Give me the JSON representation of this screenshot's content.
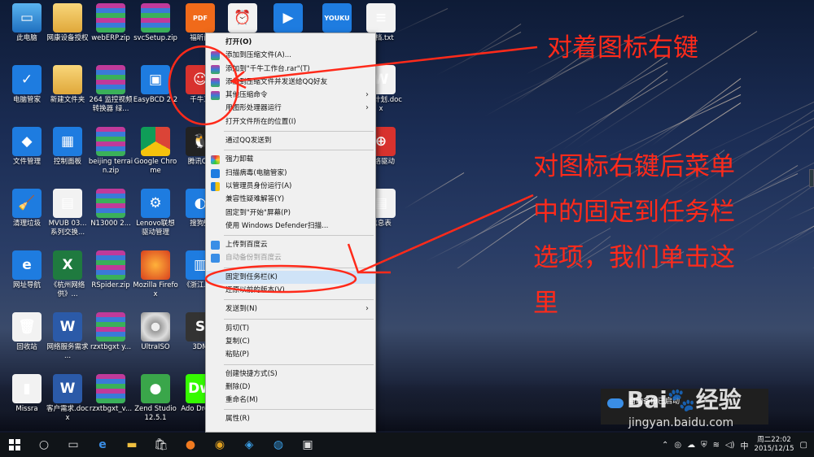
{
  "desktop_icons": [
    {
      "label": "此电脑",
      "glyph": "▭",
      "style": "g-pc",
      "col": 0,
      "row": 0
    },
    {
      "label": "网康设备授权",
      "glyph": "",
      "style": "g-folder",
      "col": 1,
      "row": 0
    },
    {
      "label": "webERP.zip",
      "glyph": "",
      "style": "g-rar",
      "col": 2,
      "row": 0
    },
    {
      "label": "svcSetup.zip",
      "glyph": "",
      "style": "g-rar",
      "col": 3,
      "row": 0
    },
    {
      "label": "福昕阅",
      "glyph": "PDF",
      "style": "g-orange",
      "col": 4,
      "row": 0
    },
    {
      "label": "",
      "glyph": "⏰",
      "style": "g-white",
      "col": 5,
      "row": 0
    },
    {
      "label": "",
      "glyph": "▶",
      "style": "g-blue",
      "col": 6,
      "row": 0
    },
    {
      "label": "",
      "glyph": "YOUKU",
      "style": "g-blue",
      "col": 7,
      "row": 0
    },
    {
      "label": "文档.txt",
      "glyph": "≡",
      "style": "g-white",
      "col": 8,
      "row": 0
    },
    {
      "label": "电脑管家",
      "glyph": "✓",
      "style": "g-blue",
      "col": 0,
      "row": 1
    },
    {
      "label": "新建文件夹",
      "glyph": "",
      "style": "g-folder",
      "col": 1,
      "row": 1
    },
    {
      "label": "264 监控视频转换器 绿...",
      "glyph": "",
      "style": "g-rar",
      "col": 2,
      "row": 1
    },
    {
      "label": "EasyBCD 2.2",
      "glyph": "▣",
      "style": "g-blue",
      "col": 3,
      "row": 1
    },
    {
      "label": "千牛工",
      "glyph": "☺",
      "style": "g-red",
      "col": 4,
      "row": 1
    },
    {
      "label": "工作计划.docx",
      "glyph": "W",
      "style": "g-white",
      "col": 8,
      "row": 1
    },
    {
      "label": "文件管理",
      "glyph": "◆",
      "style": "g-blue",
      "col": 0,
      "row": 2
    },
    {
      "label": "控制面板",
      "glyph": "▦",
      "style": "g-blue",
      "col": 1,
      "row": 2
    },
    {
      "label": "beijing terrain.zip",
      "glyph": "",
      "style": "g-rar",
      "col": 2,
      "row": 2
    },
    {
      "label": "Google Chrome",
      "glyph": "",
      "style": "g-chrome",
      "col": 3,
      "row": 2
    },
    {
      "label": "腾讯QQ",
      "glyph": "🐧",
      "style": "g-qq",
      "col": 4,
      "row": 2
    },
    {
      "label": "网络驱动",
      "glyph": "⊕",
      "style": "g-red",
      "col": 8,
      "row": 2
    },
    {
      "label": "清理垃圾",
      "glyph": "🧹",
      "style": "g-blue",
      "col": 0,
      "row": 3
    },
    {
      "label": "MVUB 03... 系列交换...",
      "glyph": "▤",
      "style": "g-white",
      "col": 1,
      "row": 3
    },
    {
      "label": "N13000 2...",
      "glyph": "",
      "style": "g-rar",
      "col": 2,
      "row": 3
    },
    {
      "label": "Lenovo联想驱动管理",
      "glyph": "⚙",
      "style": "g-blue",
      "col": 3,
      "row": 3
    },
    {
      "label": "搜狗壁",
      "glyph": "◐",
      "style": "g-blue",
      "col": 4,
      "row": 3
    },
    {
      "label": "信息表",
      "glyph": "▤",
      "style": "g-white",
      "col": 8,
      "row": 3
    },
    {
      "label": "网址导航",
      "glyph": "e",
      "style": "g-blue",
      "col": 0,
      "row": 4
    },
    {
      "label": "《杭州网络供》...",
      "glyph": "X",
      "style": "g-excel",
      "col": 1,
      "row": 4
    },
    {
      "label": "RSpider.zip",
      "glyph": "",
      "style": "g-rar",
      "col": 2,
      "row": 4
    },
    {
      "label": "Mozilla Firefox",
      "glyph": "",
      "style": "g-ff",
      "col": 3,
      "row": 4
    },
    {
      "label": "《浙江...》",
      "glyph": "▥",
      "style": "g-blue",
      "col": 4,
      "row": 4
    },
    {
      "label": "回收站",
      "glyph": "🗑",
      "style": "g-white",
      "col": 0,
      "row": 5
    },
    {
      "label": "网络服务需求 ...",
      "glyph": "W",
      "style": "g-word",
      "col": 1,
      "row": 5
    },
    {
      "label": "rzxtbgxt y...",
      "glyph": "",
      "style": "g-rar",
      "col": 2,
      "row": 5
    },
    {
      "label": "UltraISO",
      "glyph": "",
      "style": "g-cd",
      "col": 3,
      "row": 5
    },
    {
      "label": "3DM",
      "glyph": "S",
      "style": "g-dark",
      "col": 4,
      "row": 5
    },
    {
      "label": "Missra",
      "glyph": "▮",
      "style": "g-white",
      "col": 0,
      "row": 6
    },
    {
      "label": "客户需求.docx",
      "glyph": "W",
      "style": "g-word",
      "col": 1,
      "row": 6
    },
    {
      "label": "rzxtbgxt_v...",
      "glyph": "",
      "style": "g-rar",
      "col": 2,
      "row": 6
    },
    {
      "label": "Zend Studio 12.5.1",
      "glyph": "●",
      "style": "g-green",
      "col": 3,
      "row": 6
    },
    {
      "label": "Ado Dream",
      "glyph": "Dw",
      "style": "g-dw",
      "col": 4,
      "row": 6
    }
  ],
  "context_menu": {
    "items": [
      {
        "label": "打开(O)",
        "type": "item",
        "bold": true
      },
      {
        "label": "添加到压缩文件(A)...",
        "type": "item",
        "icon": "rar"
      },
      {
        "label": "添加到\"千牛工作台.rar\"(T)",
        "type": "item",
        "icon": "rar"
      },
      {
        "label": "添加到压缩文件并发送给QQ好友",
        "type": "item",
        "icon": "rar"
      },
      {
        "label": "其他压缩命令",
        "type": "item",
        "icon": "rar",
        "submenu": true
      },
      {
        "label": "用图形处理器运行",
        "type": "item",
        "submenu": true
      },
      {
        "label": "打开文件所在的位置(I)",
        "type": "item"
      },
      {
        "type": "sep"
      },
      {
        "label": "通过QQ发送到",
        "type": "item"
      },
      {
        "type": "sep"
      },
      {
        "label": "强力卸载",
        "type": "item",
        "icon": "flower"
      },
      {
        "label": "扫描病毒(电脑管家)",
        "type": "item",
        "icon": "shield"
      },
      {
        "label": "以管理员身份运行(A)",
        "type": "item",
        "icon": "uac"
      },
      {
        "label": "兼容性疑难解答(Y)",
        "type": "item"
      },
      {
        "label": "固定到\"开始\"屏幕(P)",
        "type": "item"
      },
      {
        "label": "使用 Windows Defender扫描...",
        "type": "item"
      },
      {
        "type": "sep"
      },
      {
        "label": "上传到百度云",
        "type": "item",
        "icon": "cloud"
      },
      {
        "label": "自动备份到百度云",
        "type": "item",
        "icon": "cloud",
        "disabled": true
      },
      {
        "type": "sep"
      },
      {
        "label": "固定到任务栏(K)",
        "type": "item",
        "highlight": true
      },
      {
        "label": "还原以前的版本(V)",
        "type": "item"
      },
      {
        "type": "sep"
      },
      {
        "label": "发送到(N)",
        "type": "item",
        "submenu": true
      },
      {
        "type": "sep"
      },
      {
        "label": "剪切(T)",
        "type": "item"
      },
      {
        "label": "复制(C)",
        "type": "item"
      },
      {
        "label": "粘贴(P)",
        "type": "item"
      },
      {
        "type": "sep"
      },
      {
        "label": "创建快捷方式(S)",
        "type": "item"
      },
      {
        "label": "删除(D)",
        "type": "item"
      },
      {
        "label": "重命名(M)",
        "type": "item"
      },
      {
        "type": "sep"
      },
      {
        "label": "属性(R)",
        "type": "item"
      }
    ]
  },
  "annotations": {
    "label_1": "对着图标右键",
    "label_2_lines": [
      "对图标右键后菜单",
      "中的固定到任务栏",
      "选项，我们单击这",
      "里"
    ],
    "color": "#ff2a1a"
  },
  "notification": {
    "text": "自动备份已启动"
  },
  "watermark": {
    "brand": "Bai",
    "brand2": "经验",
    "url": "jingyan.baidu.com"
  },
  "taskbar": {
    "clock_time": "周二22:02",
    "clock_date": "2015/12/15",
    "ime": "中"
  }
}
